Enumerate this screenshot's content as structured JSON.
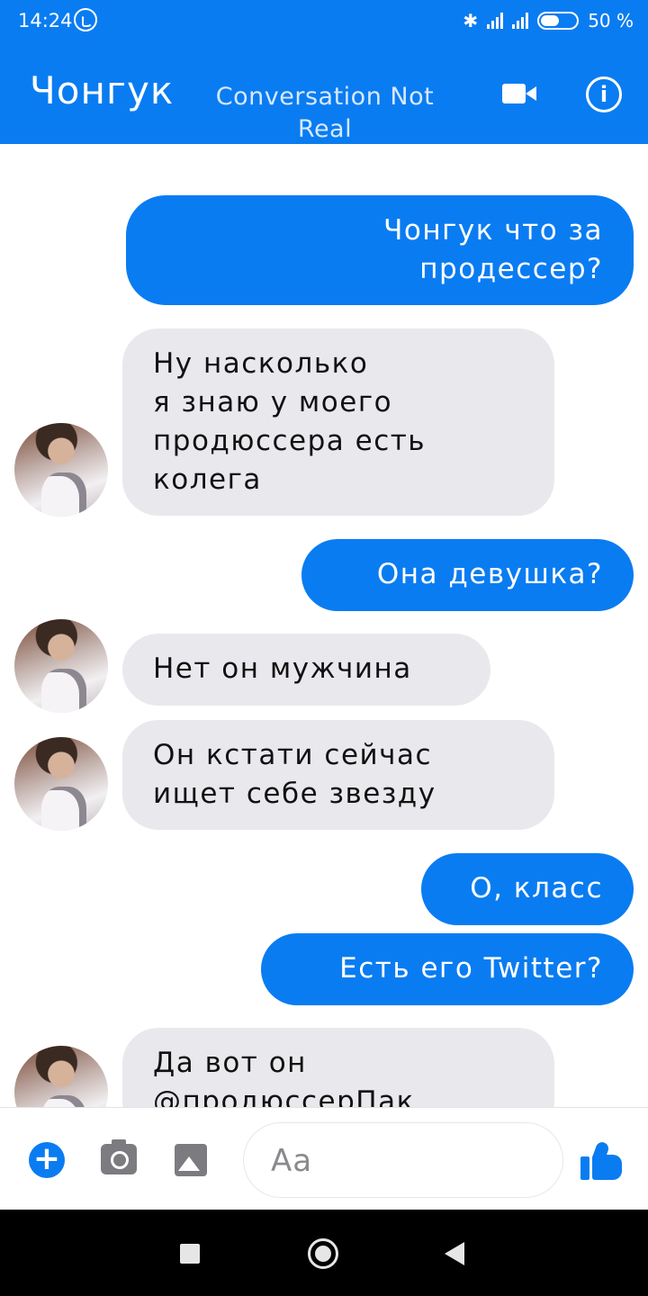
{
  "status_bar": {
    "time": "14:24",
    "network": "4G",
    "battery": "50 %"
  },
  "header": {
    "contact_name": "Чонгук",
    "subtitle": "Conversation Not Real"
  },
  "messages": [
    {
      "from": "me",
      "text": "Чонгук что за\nпродессер?"
    },
    {
      "from": "contact",
      "text": "Ну  насколько\nя знаю у моего\nпродюссера есть\nколега"
    },
    {
      "from": "me",
      "text": "Она девушка?"
    },
    {
      "from": "contact",
      "text": "Нет он мужчина"
    },
    {
      "from": "contact",
      "text": "Он кстати сейчас\nищет себе звезду"
    },
    {
      "from": "me",
      "text": "О, класс"
    },
    {
      "from": "me",
      "text": "Есть его Twitter?"
    },
    {
      "from": "contact",
      "text": "Да вот он\n@продюссерПак"
    }
  ],
  "composer": {
    "placeholder": "Aa",
    "icons": [
      "plus-icon",
      "camera-icon",
      "image-icon",
      "like-icon"
    ]
  },
  "navbar": {
    "icons": [
      "recent-apps-icon",
      "home-icon",
      "back-icon"
    ]
  },
  "colors": {
    "accent": "#0a7cf1",
    "incoming_bubble": "#e9e9ed"
  }
}
